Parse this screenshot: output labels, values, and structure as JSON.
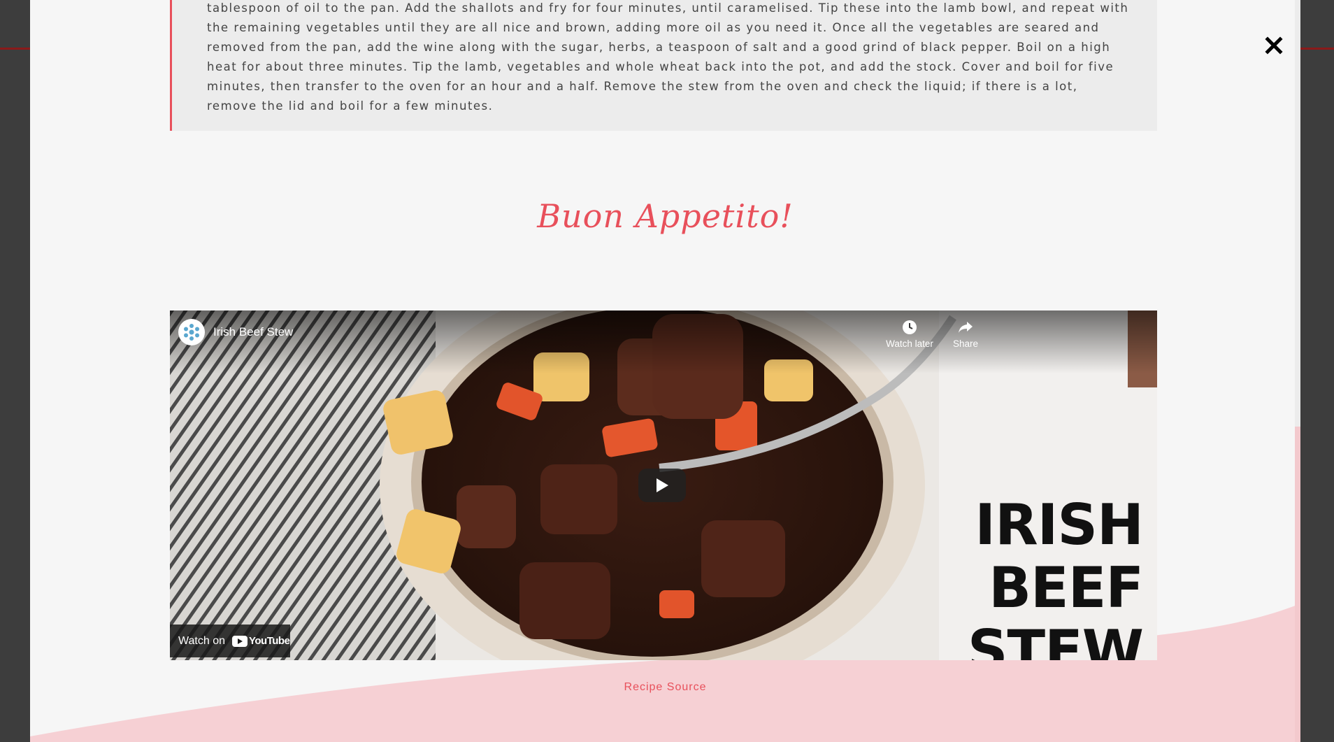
{
  "recipe": {
    "method_text": "tablespoon of oil to the pan. Add the shallots and fry for four minutes, until caramelised. Tip these into the lamb bowl, and repeat with the remaining vegetables until they are all nice and brown, adding more oil as you need it. Once all the vegetables are seared and removed from the pan, add the wine along with the sugar, herbs, a teaspoon of salt and a good grind of black pepper. Boil on a high heat for about three minutes. Tip the lamb, vegetables and whole wheat back into the pot, and add the stock. Cover and boil for five minutes, then transfer to the oven for an hour and a half. Remove the stew from the oven and check the liquid; if there is a lot, remove the lid and boil for a few minutes.",
    "closing_heading": "Buon Appetito!",
    "source_link": "Recipe Source"
  },
  "video": {
    "title": "Irish Beef Stew",
    "watch_later_label": "Watch later",
    "share_label": "Share",
    "watch_on_label": "Watch on",
    "platform_wordmark": "YouTube",
    "thumbnail_text": [
      "IRISH",
      "BEEF",
      "STEW"
    ]
  },
  "modal": {
    "close_icon": "close-icon"
  },
  "colors": {
    "accent": "#e8505b",
    "pink_band": "#f6d0d4",
    "quote_bg": "#ececec",
    "backdrop": "#3d3d3d"
  }
}
